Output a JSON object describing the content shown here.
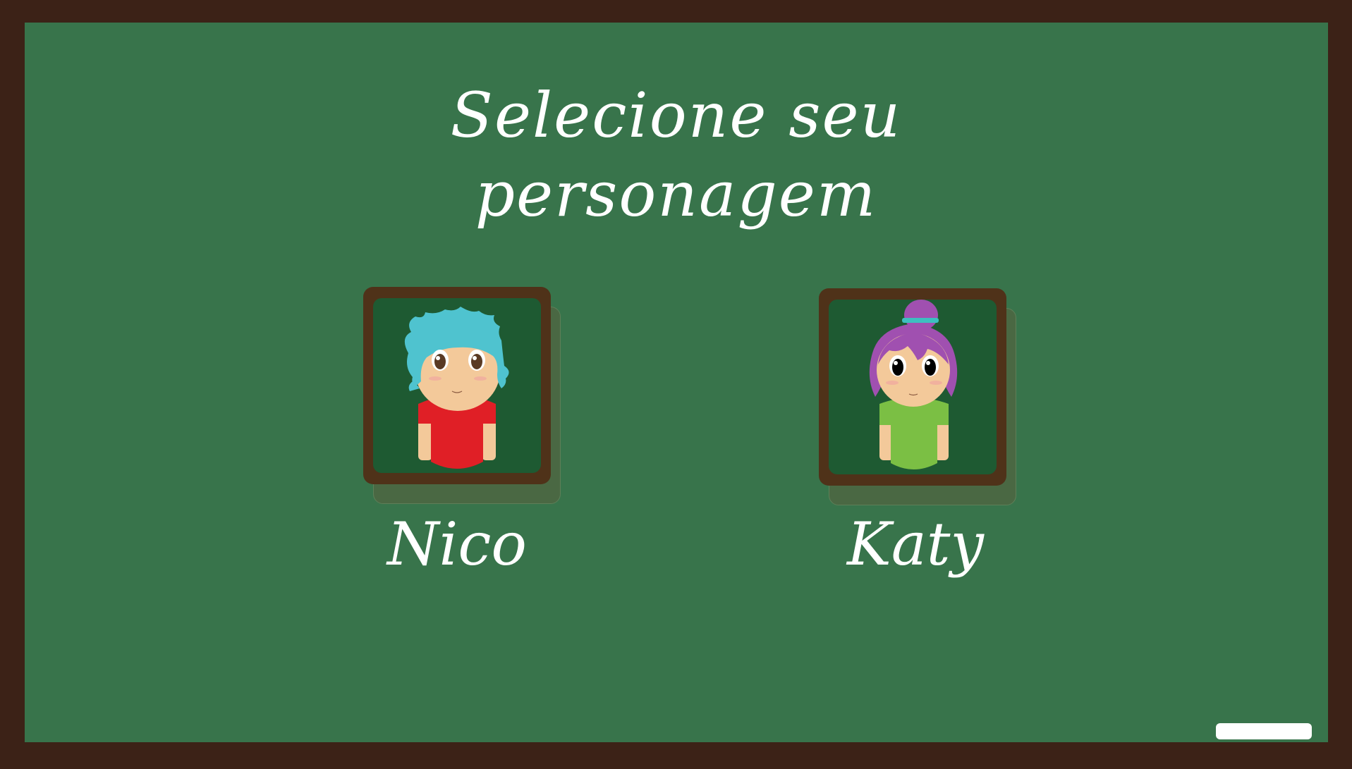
{
  "title": {
    "line1": "Selecione seu",
    "line2": "personagem"
  },
  "characters": [
    {
      "name": "Nico",
      "hair_color": "#4fc3cf",
      "shirt_color": "#e01f26",
      "eye_color": "#5a3a24"
    },
    {
      "name": "Katy",
      "hair_color": "#a050b0",
      "shirt_color": "#7bbf44",
      "eye_color": "#000000"
    }
  ],
  "colors": {
    "board": "#38744b",
    "frame": "#3c2217",
    "card_frame": "#4f3219",
    "card_bg": "#1e5a32",
    "skin": "#f3c99a"
  },
  "icons": [
    "nico-portrait-icon",
    "katy-portrait-icon",
    "chalk-icon"
  ]
}
